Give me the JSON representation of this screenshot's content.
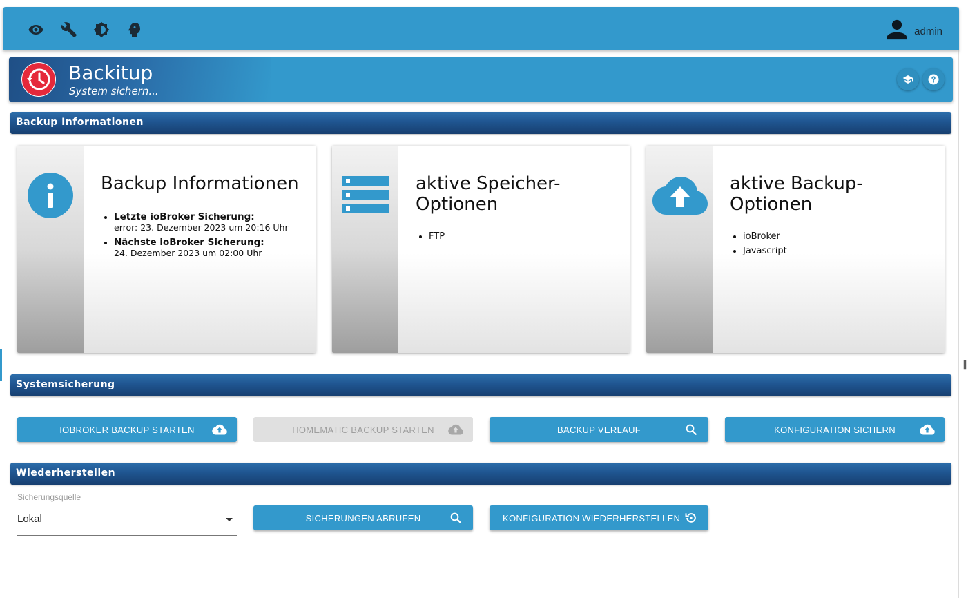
{
  "topbar": {
    "icons": [
      "eye-icon",
      "wrench-icon",
      "brightness-icon",
      "head-icon"
    ],
    "user_label": "admin"
  },
  "header": {
    "title": "Backitup",
    "subtitle": "System sichern..."
  },
  "sections": {
    "info": "Backup Informationen",
    "system": "Systemsicherung",
    "restore": "Wiederherstellen"
  },
  "cards": {
    "info": {
      "title": "Backup Informationen",
      "items": [
        {
          "label": "Letzte ioBroker Sicherung:",
          "value": "error: 23. Dezember 2023 um 20:16 Uhr"
        },
        {
          "label": "Nächste ioBroker Sicherung:",
          "value": "24. Dezember 2023 um 02:00 Uhr"
        }
      ]
    },
    "storage": {
      "title": "aktive Speicher-Optionen",
      "items": [
        "FTP"
      ]
    },
    "backup": {
      "title": "aktive Backup-Optionen",
      "items": [
        "ioBroker",
        "Javascript"
      ]
    }
  },
  "buttons": {
    "iobroker_backup": "IOBROKER BACKUP STARTEN",
    "homematic_backup": "HOMEMATIC BACKUP STARTEN",
    "backup_history": "BACKUP VERLAUF",
    "save_config": "KONFIGURATION SICHERN",
    "fetch_backups": "SICHERUNGEN ABRUFEN",
    "restore_config": "KONFIGURATION WIEDERHERSTELLEN"
  },
  "restore": {
    "source_label": "Sicherungsquelle",
    "source_value": "Lokal"
  },
  "colors": {
    "primary": "#3399cc",
    "section": "#1f5590",
    "logo": "#e5293b"
  }
}
